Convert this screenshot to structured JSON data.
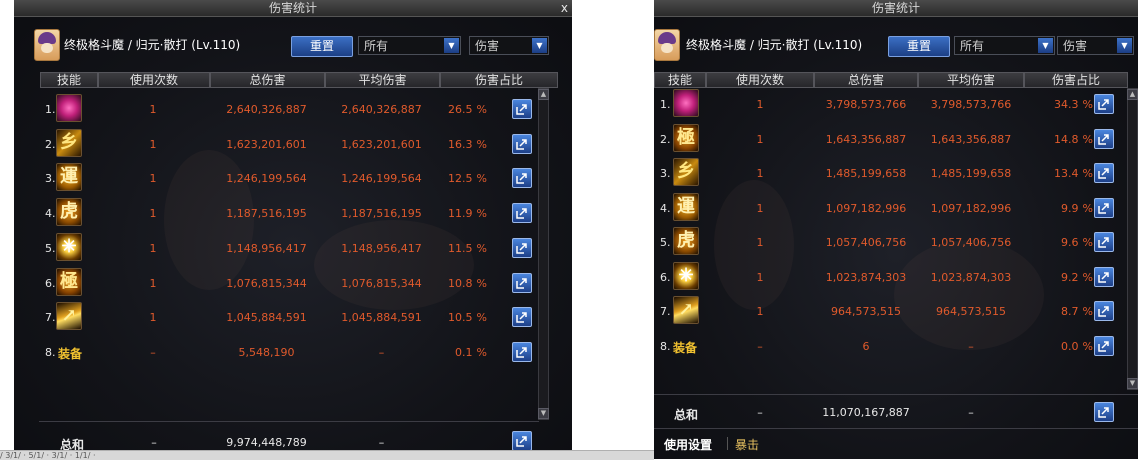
{
  "window_title": "伤害统计",
  "close_glyph": "x",
  "character": "终极格斗魔 / 归元·散打 (Lv.110)",
  "reset_label": "重置",
  "filter_target": "所有",
  "filter_type": "伤害",
  "columns": [
    "技能",
    "使用次数",
    "总伤害",
    "平均伤害",
    "伤害占比"
  ],
  "percent_sign": "%",
  "total_label": "总和",
  "left": {
    "rows": [
      {
        "rank": "1.",
        "icon": "sk-a",
        "glyph": "",
        "count": "1",
        "total": "2,640,326,887",
        "avg": "2,640,326,887",
        "share": "26.5"
      },
      {
        "rank": "2.",
        "icon": "sk-b",
        "glyph": "乡",
        "count": "1",
        "total": "1,623,201,601",
        "avg": "1,623,201,601",
        "share": "16.3"
      },
      {
        "rank": "3.",
        "icon": "sk-c",
        "glyph": "運",
        "count": "1",
        "total": "1,246,199,564",
        "avg": "1,246,199,564",
        "share": "12.5"
      },
      {
        "rank": "4.",
        "icon": "sk-d",
        "glyph": "虎",
        "count": "1",
        "total": "1,187,516,195",
        "avg": "1,187,516,195",
        "share": "11.9"
      },
      {
        "rank": "5.",
        "icon": "sk-e",
        "glyph": "✳",
        "count": "1",
        "total": "1,148,956,417",
        "avg": "1,148,956,417",
        "share": "11.5"
      },
      {
        "rank": "6.",
        "icon": "sk-f",
        "glyph": "極",
        "count": "1",
        "total": "1,076,815,344",
        "avg": "1,076,815,344",
        "share": "10.8"
      },
      {
        "rank": "7.",
        "icon": "sk-g",
        "glyph": "↗",
        "count": "1",
        "total": "1,045,884,591",
        "avg": "1,045,884,591",
        "share": "10.5"
      },
      {
        "rank": "8.",
        "icon": "",
        "name": "装备",
        "count": "–",
        "total": "5,548,190",
        "avg": "–",
        "share": "0.1"
      }
    ],
    "total": {
      "count": "–",
      "total": "9,974,448,789",
      "avg": "–"
    }
  },
  "right": {
    "rows": [
      {
        "rank": "1.",
        "icon": "sk-a",
        "glyph": "",
        "count": "1",
        "total": "3,798,573,766",
        "avg": "3,798,573,766",
        "share": "34.3"
      },
      {
        "rank": "2.",
        "icon": "sk-f",
        "glyph": "極",
        "count": "1",
        "total": "1,643,356,887",
        "avg": "1,643,356,887",
        "share": "14.8"
      },
      {
        "rank": "3.",
        "icon": "sk-b",
        "glyph": "乡",
        "count": "1",
        "total": "1,485,199,658",
        "avg": "1,485,199,658",
        "share": "13.4"
      },
      {
        "rank": "4.",
        "icon": "sk-c",
        "glyph": "運",
        "count": "1",
        "total": "1,097,182,996",
        "avg": "1,097,182,996",
        "share": "9.9"
      },
      {
        "rank": "5.",
        "icon": "sk-d",
        "glyph": "虎",
        "count": "1",
        "total": "1,057,406,756",
        "avg": "1,057,406,756",
        "share": "9.6"
      },
      {
        "rank": "6.",
        "icon": "sk-e",
        "glyph": "✳",
        "count": "1",
        "total": "1,023,874,303",
        "avg": "1,023,874,303",
        "share": "9.2"
      },
      {
        "rank": "7.",
        "icon": "sk-g",
        "glyph": "↗",
        "count": "1",
        "total": "964,573,515",
        "avg": "964,573,515",
        "share": "8.7"
      },
      {
        "rank": "8.",
        "icon": "",
        "name": "装备",
        "count": "–",
        "total": "6",
        "avg": "–",
        "share": "0.0"
      }
    ],
    "total": {
      "count": "–",
      "total": "11,070,167,887",
      "avg": "–"
    },
    "tabs": [
      "使用设置",
      "暴击"
    ]
  },
  "taskbar_text": "/ 3/1/ · 5/1/ · 3/1/ · 1/1/ ·",
  "colors": {
    "accent": "#2a5bb8",
    "damage": "#e05a2c",
    "skill_name": "#f2c230"
  }
}
